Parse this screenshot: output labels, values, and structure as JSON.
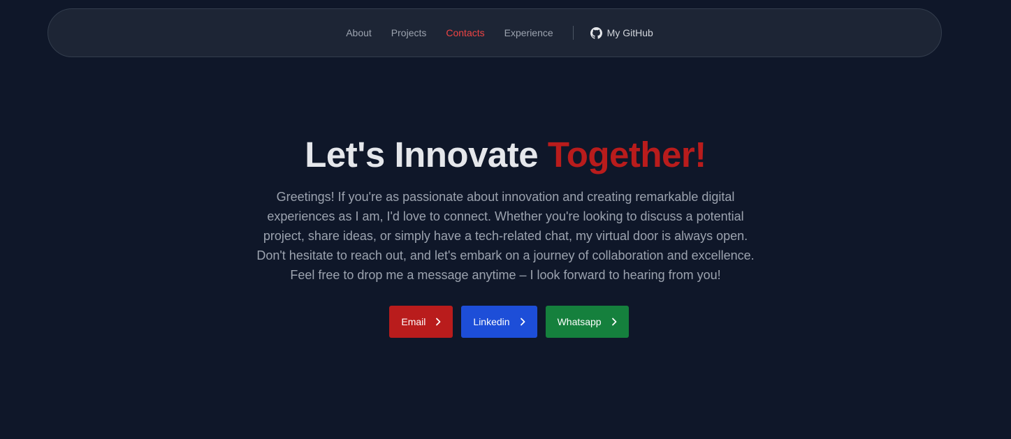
{
  "nav": {
    "links": [
      {
        "label": "About"
      },
      {
        "label": "Projects"
      },
      {
        "label": "Contacts",
        "active": true
      },
      {
        "label": "Experience"
      }
    ],
    "github_label": "My GitHub",
    "github_icon": "github-icon"
  },
  "hero": {
    "title_main": "Let's Innovate",
    "title_accent": "Together!",
    "lines": [
      "Greetings! If you're as passionate about innovation and creating remarkable digital",
      "experiences as I am, I'd love to connect. Whether you're looking to discuss a potential",
      "project, share ideas, or simply have a tech-related chat, my virtual door is always open.",
      "Don't hesitate to reach out, and let's embark on a journey of collaboration and excellence.",
      "Feel free to drop me a message anytime – I look forward to hearing from you!"
    ]
  },
  "buttons": {
    "email": "Email",
    "linkedin": "Linkedin",
    "whatsapp": "Whatsapp",
    "chevron_icon": "chevron-right-icon"
  },
  "colors": {
    "background": "#0f1729",
    "accent": "#ef4444",
    "email": "#b91c1c",
    "linkedin": "#1d4ed8",
    "whatsapp": "#15803d"
  }
}
